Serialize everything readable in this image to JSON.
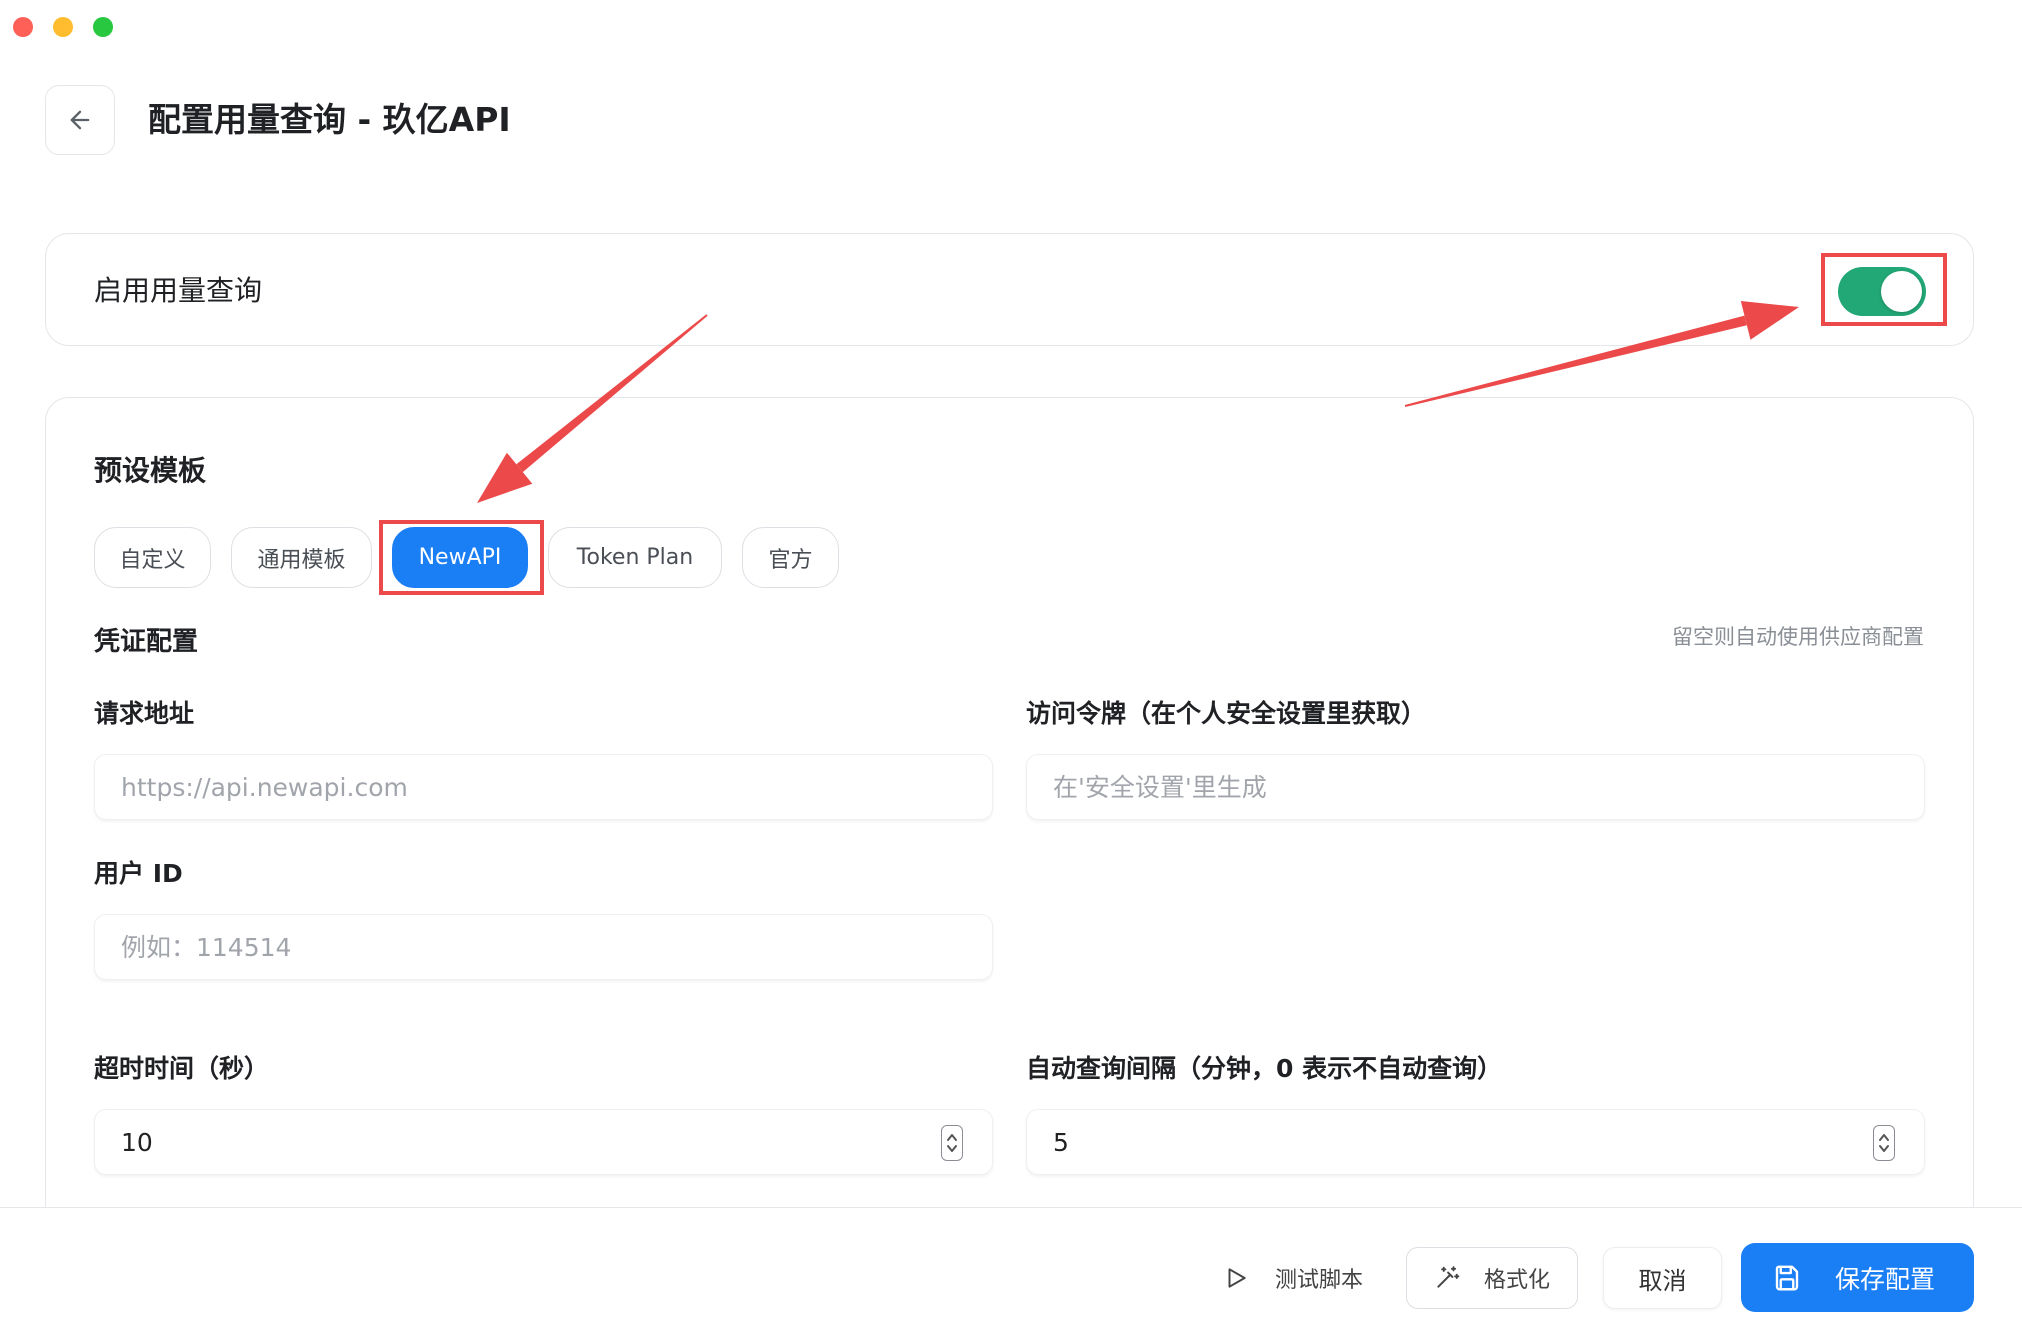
{
  "header": {
    "back_icon": "arrow-left-icon",
    "title": "配置用量查询 - 玖亿API"
  },
  "enable_card": {
    "label": "启用用量查询",
    "enabled": true
  },
  "templates": {
    "heading": "预设模板",
    "items": [
      {
        "label": "自定义",
        "selected": false
      },
      {
        "label": "通用模板",
        "selected": false
      },
      {
        "label": "NewAPI",
        "selected": true
      },
      {
        "label": "Token Plan",
        "selected": false
      },
      {
        "label": "官方",
        "selected": false
      }
    ]
  },
  "credentials": {
    "heading": "凭证配置",
    "hint": "留空则自动使用供应商配置",
    "request_url": {
      "label": "请求地址",
      "placeholder": "https://api.newapi.com"
    },
    "access_token": {
      "label": "访问令牌（在个人安全设置里获取）",
      "placeholder": "在'安全设置'里生成"
    },
    "user_id": {
      "label": "用户 ID",
      "placeholder": "例如：114514"
    }
  },
  "timing": {
    "timeout": {
      "label": "超时时间（秒）",
      "value": "10"
    },
    "interval": {
      "label": "自动查询间隔（分钟，0 表示不自动查询）",
      "value": "5"
    }
  },
  "footer": {
    "test_label": "测试脚本",
    "format_label": "格式化",
    "cancel_label": "取消",
    "save_label": "保存配置"
  },
  "icons": {
    "back": "arrow-left-icon",
    "test": "play-icon",
    "format": "magic-wand-icon",
    "save": "save-icon",
    "spinner": "chevron-up-down-icon"
  },
  "colors": {
    "accent": "#1a7ef5",
    "toggle_on": "#22a776",
    "annotation": "#ec4a4a"
  }
}
